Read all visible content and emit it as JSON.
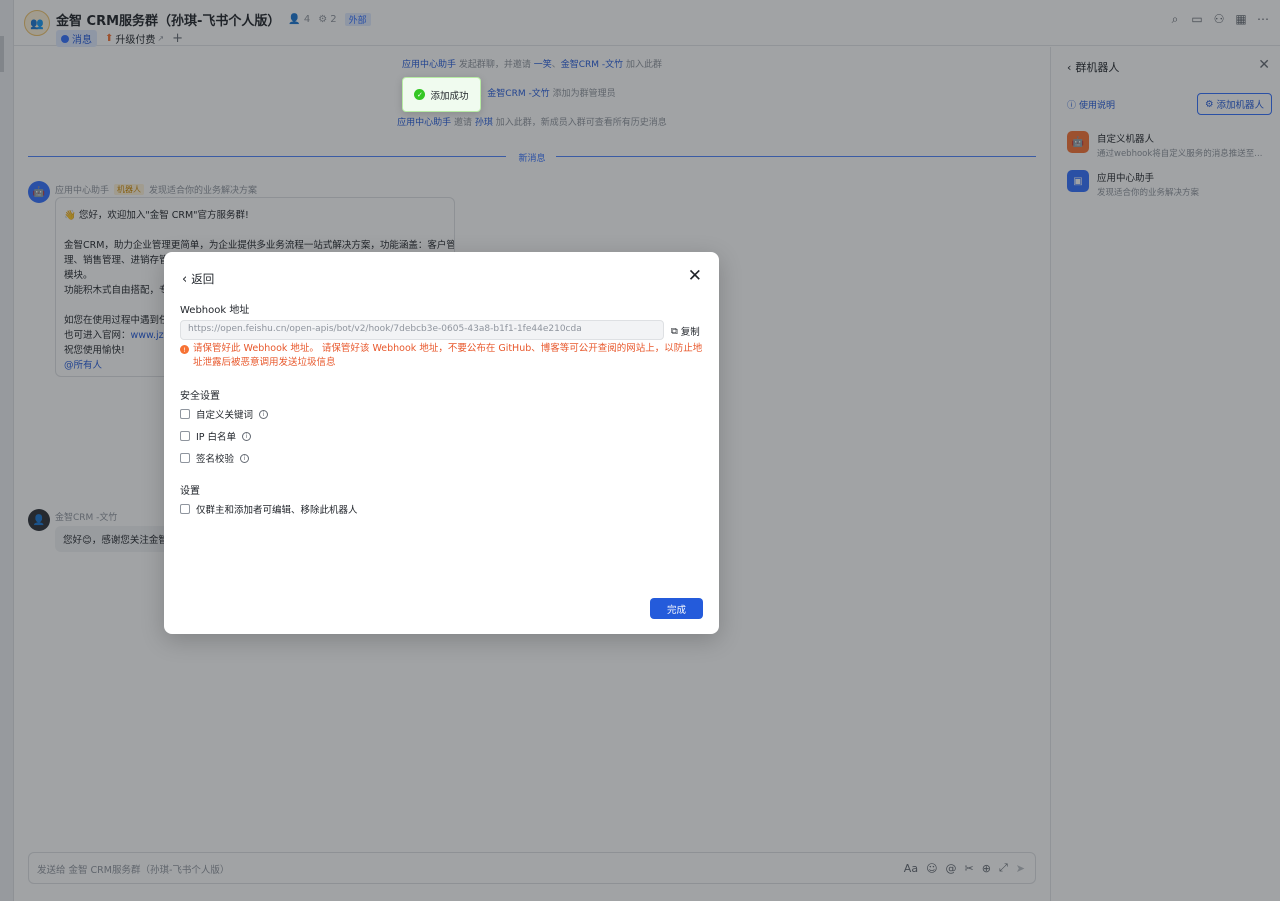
{
  "header": {
    "title": "金智 CRM服务群（孙琪-飞书个人版）",
    "member_count": "4",
    "bot_count": "2",
    "external_tag": "外部",
    "tab_message": "消息",
    "tab_upgrade": "升级付费",
    "tab_add": "+"
  },
  "chat": {
    "sys1": {
      "a": "应用中心助手",
      "b": " 发起群聊，并邀请 ",
      "c": "一笑",
      "d": "、",
      "e": "金智CRM -文竹",
      "f": " 加入此群"
    },
    "sys2": {
      "a": "将 ",
      "b": "一笑",
      "c": "、",
      "d": "金智CRM -文竹",
      "e": " 添加为群管理员"
    },
    "sys3": {
      "a": "应用中心助手",
      "b": " 邀请 ",
      "c": "孙琪",
      "d": " 加入此群，新成员入群可查看所有历史消息"
    },
    "new_messages": "新消息",
    "bot_sender": "应用中心助手",
    "bot_tag": "机器人",
    "bot_sender_desc": "发现适合你的业务解决方案",
    "card_lines": [
      "👋 您好，欢迎加入\"金智 CRM\"官方服务群!",
      "金智CRM，助力企业管理更简单，为企业提供多业务流程一站式解决方案，功能涵盖：客户管",
      "理、销售管理、进销存管",
      "模块。",
      "功能积木式自由搭配，专",
      "如您在使用过程中遇到任",
      "也可进入官网：",
      "祝您使用愉快!"
    ],
    "card_link": "www.jzs",
    "card_mention": "@所有人",
    "user_sender": "金智CRM -文竹",
    "user_bubble": "您好😊，感谢您关注金智"
  },
  "composer": {
    "placeholder": "发送给 金智 CRM服务群（孙琪-飞书个人版）"
  },
  "panel": {
    "title": "群机器人",
    "usage": "使用说明",
    "add_bot": "添加机器人",
    "bots": [
      {
        "name": "自定义机器人",
        "desc": "通过webhook将自定义服务的消息推送至..."
      },
      {
        "name": "应用中心助手",
        "desc": "发现适合你的业务解决方案"
      }
    ]
  },
  "toast": {
    "text": "添加成功"
  },
  "modal": {
    "back": "返回",
    "webhook_label": "Webhook 地址",
    "webhook_url": "https://open.feishu.cn/open-apis/bot/v2/hook/7debcb3e-0605-43a8-b1f1-1fe44e210cda",
    "copy": "复制",
    "warning": "请保管好此 Webhook 地址。 请保管好该 Webhook 地址，不要公布在 GitHub、博客等可公开查阅的网站上，以防止地址泄露后被恶意调用发送垃圾信息",
    "security_label": "安全设置",
    "security_options": [
      "自定义关键词",
      "IP 白名单",
      "签名校验"
    ],
    "settings_label": "设置",
    "settings_option": "仅群主和添加者可编辑、移除此机器人",
    "done": "完成"
  },
  "colors": {
    "accent": "#245bdb",
    "warning": "#f54a45",
    "success": "#34c724"
  }
}
